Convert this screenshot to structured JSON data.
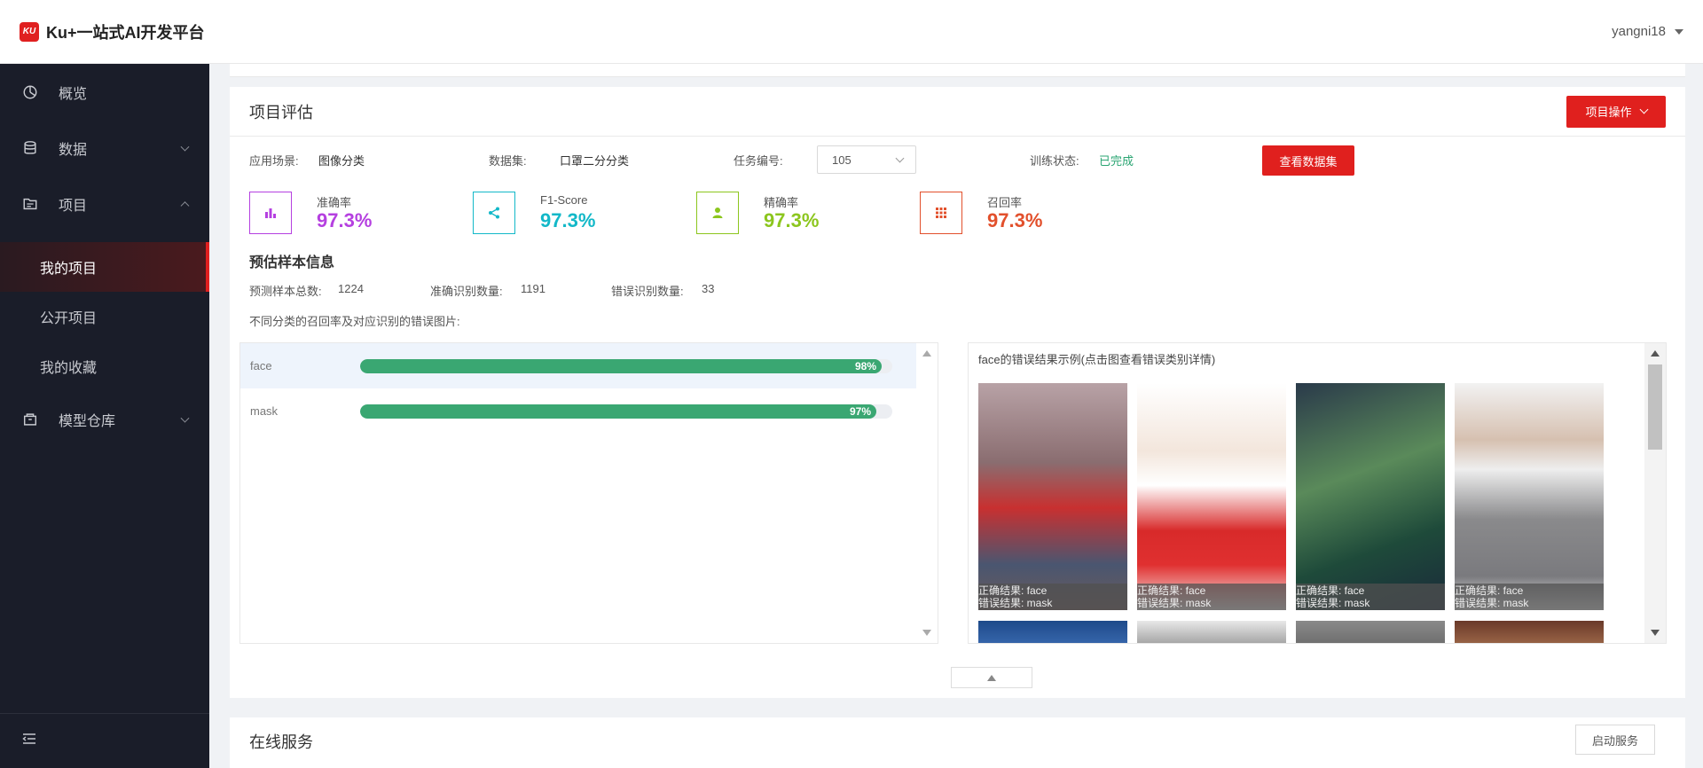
{
  "header": {
    "logo_mark": "KU",
    "app_title": "Ku+一站式AI开发平台",
    "user": "yangni18"
  },
  "sidebar": {
    "items": [
      {
        "label": "概览",
        "icon": "dashboard-icon"
      },
      {
        "label": "数据",
        "icon": "database-icon"
      },
      {
        "label": "项目",
        "icon": "folder-icon"
      },
      {
        "label": "模型仓库",
        "icon": "package-icon"
      }
    ],
    "project_sub": [
      "我的项目",
      "公开项目",
      "我的收藏"
    ],
    "active_sub": "我的项目"
  },
  "eval": {
    "title": "项目评估",
    "action_btn": "项目操作",
    "scenario_label": "应用场景:",
    "scenario_value": "图像分类",
    "dataset_label": "数据集:",
    "dataset_value": "口罩二分分类",
    "task_label": "任务编号:",
    "task_value": "105",
    "status_label": "训练状态:",
    "status_value": "已完成",
    "view_dataset_btn": "查看数据集",
    "metrics": [
      {
        "label": "准确率",
        "value": "97.3%",
        "color": "#b540e0",
        "icon": "bar-chart-icon"
      },
      {
        "label": "F1-Score",
        "value": "97.3%",
        "color": "#13b8c8",
        "icon": "share-icon"
      },
      {
        "label": "精确率",
        "value": "97.3%",
        "color": "#8cc61e",
        "icon": "user-icon"
      },
      {
        "label": "召回率",
        "value": "97.3%",
        "color": "#e2502c",
        "icon": "grid-icon"
      }
    ],
    "sample_title": "预估样本信息",
    "total_label": "预测样本总数:",
    "total_value": "1224",
    "correct_label": "准确识别数量:",
    "correct_value": "1191",
    "wrong_label": "错误识别数量:",
    "wrong_value": "33",
    "desc": "不同分类的召回率及对应识别的错误图片:",
    "classes": [
      {
        "name": "face",
        "pct": 98,
        "pct_label": "98%"
      },
      {
        "name": "mask",
        "pct": 97,
        "pct_label": "97%"
      }
    ],
    "error_title": "face的错误结果示例(点击图查看错误类别详情)",
    "error_samples": [
      {
        "correct": "正确结果: face",
        "wrong": "错误结果: mask"
      },
      {
        "correct": "正确结果: face",
        "wrong": "错误结果: mask"
      },
      {
        "correct": "正确结果: face",
        "wrong": "错误结果: mask"
      },
      {
        "correct": "正确结果: face",
        "wrong": "错误结果: mask"
      }
    ]
  },
  "online": {
    "title": "在线服务",
    "start_btn": "启动服务"
  }
}
